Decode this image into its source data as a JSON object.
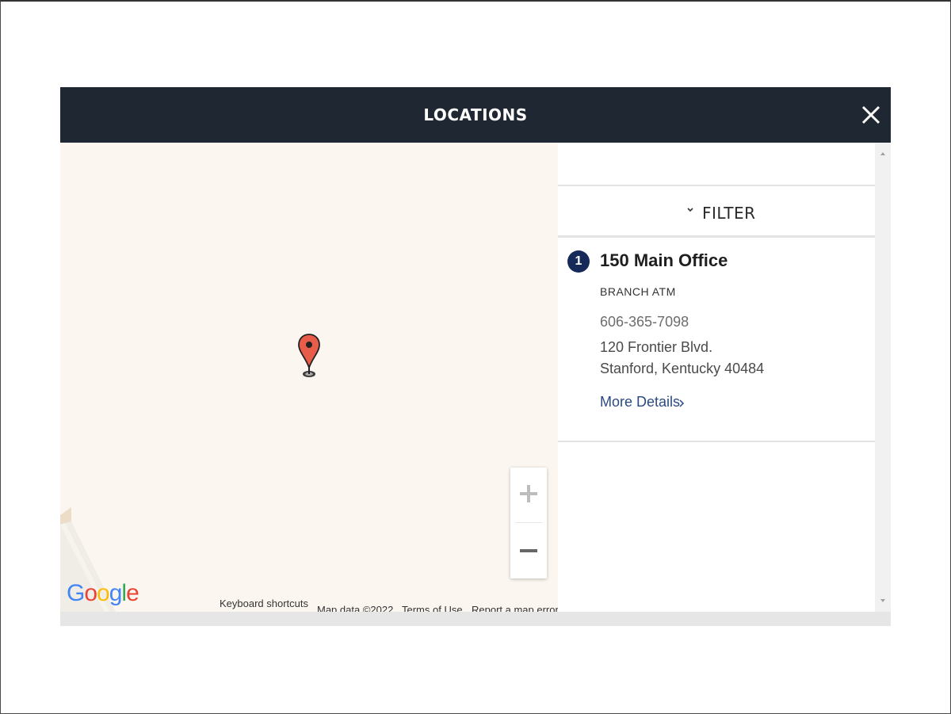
{
  "modal": {
    "title": "LOCATIONS"
  },
  "map": {
    "google_logo": [
      "G",
      "o",
      "o",
      "g",
      "l",
      "e"
    ],
    "google_colors": [
      "#4285f4",
      "#ea4335",
      "#fbbc05",
      "#4285f4",
      "#34a853",
      "#ea4335"
    ],
    "keyboard_shortcuts": "Keyboard shortcuts",
    "map_data": "Map data ©2022",
    "terms": "Terms of Use",
    "report": "Report a map error",
    "zoom_in_icon": "plus-icon",
    "zoom_out_icon": "minus-icon",
    "pin_color": "#e85d4a"
  },
  "panel": {
    "filter_label": "FILTER",
    "locations": [
      {
        "number": "1",
        "name": "150 Main Office",
        "type": "BRANCH  ATM",
        "phone": "606-365-7098",
        "address_line1": "120 Frontier Blvd.",
        "address_line2": "Stanford, Kentucky 40484",
        "more_details": "More Details"
      }
    ]
  },
  "colors": {
    "header_bg": "#1f2832",
    "accent_navy": "#162a5a",
    "link_blue": "#2a4a84",
    "map_bg": "#fcf6f0"
  }
}
